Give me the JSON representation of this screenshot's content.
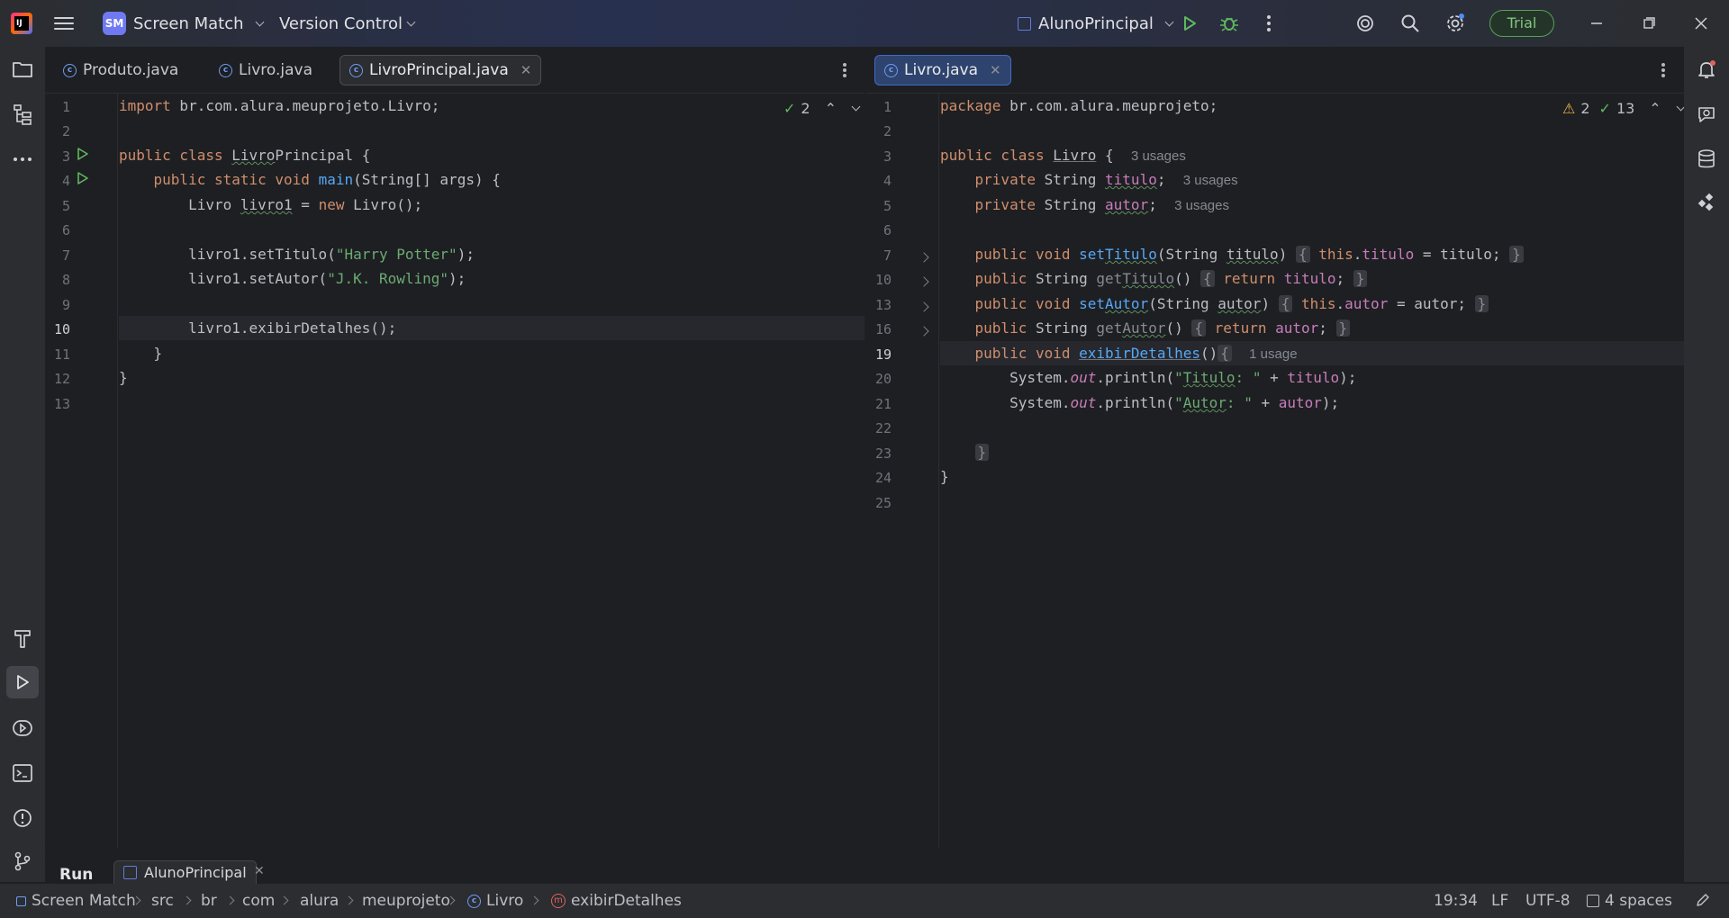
{
  "titlebar": {
    "project_badge": "SM",
    "project_name": "Screen Match",
    "vcs_label": "Version Control",
    "run_config": "AlunoPrincipal",
    "trial_label": "Trial"
  },
  "left_editor": {
    "tabs": [
      {
        "label": "Produto.java"
      },
      {
        "label": "Livro.java"
      },
      {
        "label": "LivroPrincipal.java"
      }
    ],
    "inspection_count": "2",
    "line_numbers": [
      "1",
      "2",
      "3",
      "4",
      "5",
      "6",
      "7",
      "8",
      "9",
      "10",
      "11",
      "12",
      "13"
    ],
    "current_line": "10"
  },
  "right_editor": {
    "tabs": [
      {
        "label": "Livro.java"
      }
    ],
    "warning_count": "2",
    "check_count": "13",
    "line_numbers": [
      "1",
      "2",
      "3",
      "4",
      "5",
      "6",
      "7",
      "10",
      "13",
      "16",
      "19",
      "20",
      "21",
      "22",
      "23",
      "24",
      "25"
    ],
    "current_line": "19",
    "hints": {
      "class_usages": "3 usages",
      "titulo_usages": "3 usages",
      "autor_usages": "3 usages",
      "exibir_usages": "1 usage"
    }
  },
  "run_panel": {
    "title": "Run",
    "tab_label": "AlunoPrincipal"
  },
  "statusbar": {
    "breadcrumbs": [
      "Screen Match",
      "src",
      "br",
      "com",
      "alura",
      "meuprojeto",
      "Livro",
      "exibirDetalhes"
    ],
    "position": "19:34",
    "line_ending": "LF",
    "encoding": "UTF-8",
    "indent": "4 spaces"
  },
  "colors": {
    "keyword": "#cf8e6d",
    "function": "#56a8f5",
    "string": "#6aab73",
    "field": "#c77dbb",
    "trial_border": "#56a15a",
    "accent": "#3d6cc9"
  }
}
